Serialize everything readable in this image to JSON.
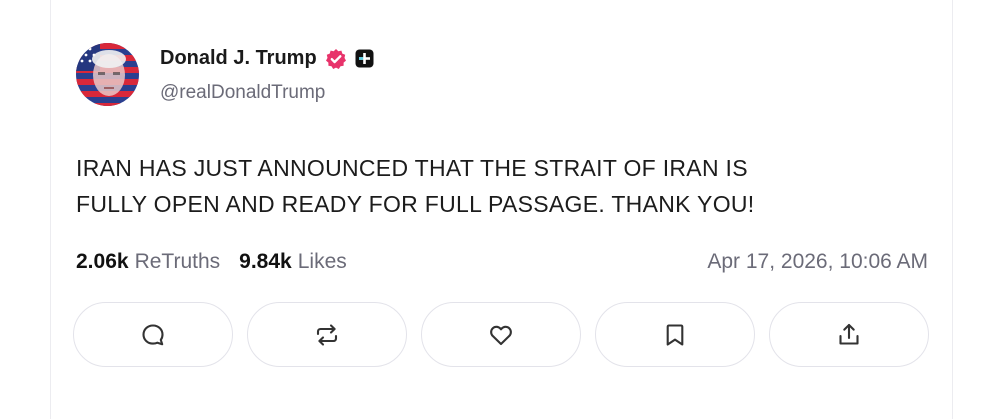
{
  "post": {
    "author": {
      "display_name": "Donald J. Trump",
      "handle": "@realDonaldTrump",
      "verified_icon": "verified-badge-icon",
      "badge_icon": "plus-badge-icon",
      "verified_color": "#e8336b"
    },
    "text": "IRAN HAS JUST ANNOUNCED THAT THE STRAIT OF IRAN IS\nFULLY OPEN AND READY FOR FULL PASSAGE. THANK YOU!",
    "stats": {
      "retruths_count": "2.06k",
      "retruths_label": "ReTruths",
      "likes_count": "9.84k",
      "likes_label": "Likes"
    },
    "timestamp": "Apr 17, 2026, 10:06 AM",
    "actions": [
      {
        "name": "reply",
        "icon": "comment-icon"
      },
      {
        "name": "retruth",
        "icon": "repost-icon"
      },
      {
        "name": "like",
        "icon": "heart-icon"
      },
      {
        "name": "bookmark",
        "icon": "bookmark-icon"
      },
      {
        "name": "share",
        "icon": "share-icon"
      }
    ]
  },
  "colors": {
    "text_primary": "#111111",
    "text_secondary": "#6b6b78",
    "border": "#e3e3ea"
  }
}
